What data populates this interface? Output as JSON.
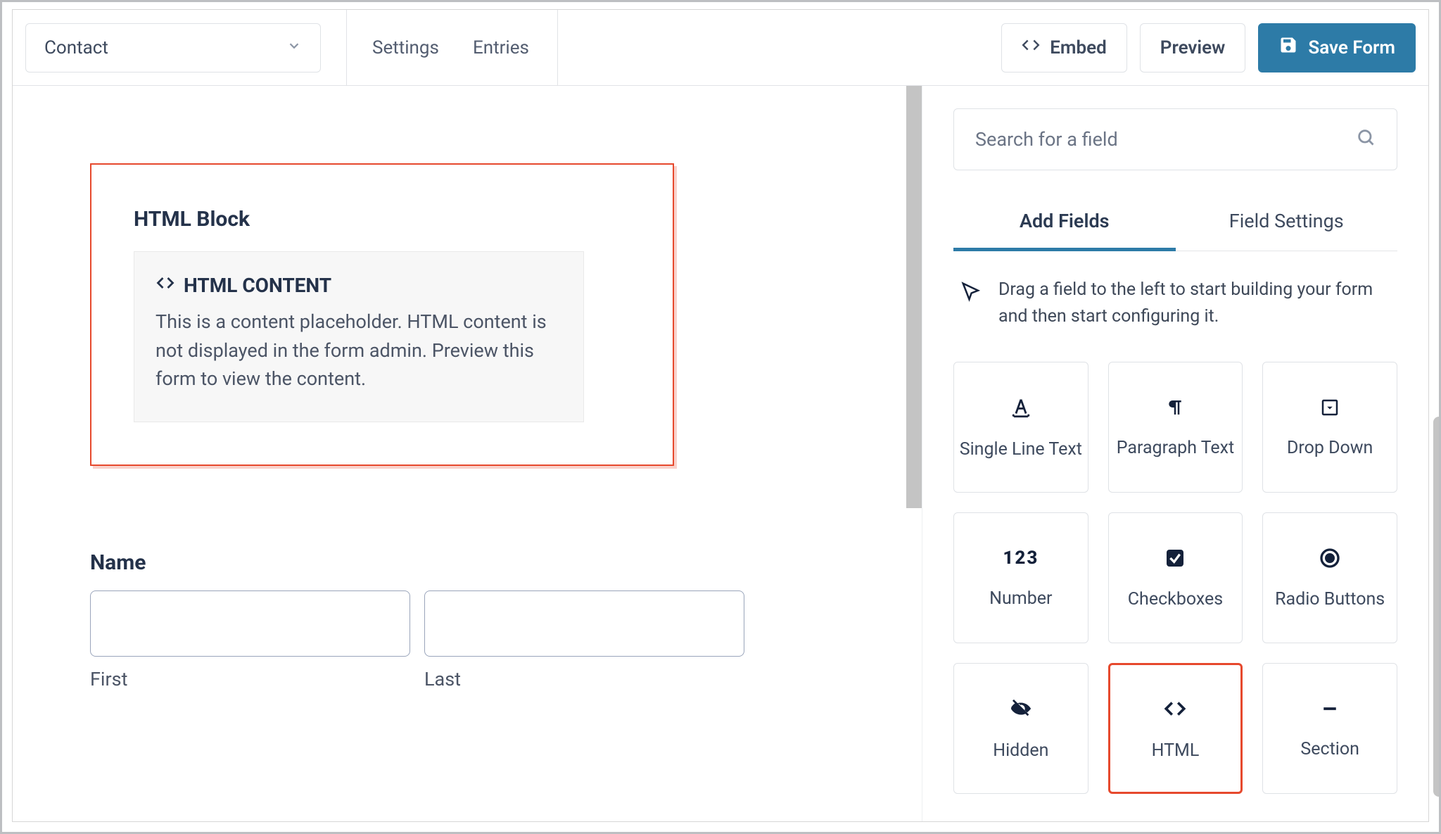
{
  "toolbar": {
    "form_name": "Contact",
    "links": {
      "settings": "Settings",
      "entries": "Entries"
    },
    "embed": "Embed",
    "preview": "Preview",
    "save": "Save Form"
  },
  "canvas": {
    "html_block": {
      "title": "HTML Block",
      "content_heading": "HTML CONTENT",
      "content_body": "This is a content placeholder. HTML content is not displayed in the form admin. Preview this form to view the content."
    },
    "name_field": {
      "label": "Name",
      "first": "First",
      "last": "Last"
    }
  },
  "panel": {
    "search_placeholder": "Search for a field",
    "tabs": {
      "add": "Add Fields",
      "settings": "Field Settings"
    },
    "hint": "Drag a field to the left to start building your form and then start configuring it.",
    "fields": {
      "single_line_text": "Single Line Text",
      "paragraph_text": "Paragraph Text",
      "dropdown": "Drop Down",
      "number": "Number",
      "checkboxes": "Checkboxes",
      "radio_buttons": "Radio Buttons",
      "hidden": "Hidden",
      "html": "HTML",
      "section": "Section"
    }
  }
}
